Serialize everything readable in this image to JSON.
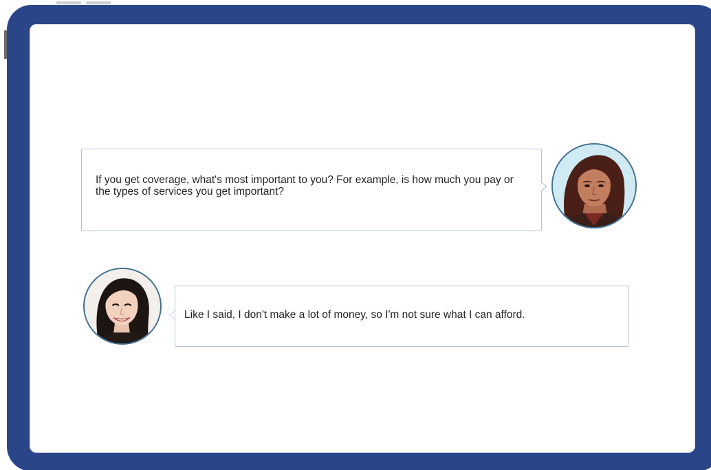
{
  "conversation": {
    "messages": [
      {
        "speaker": "agent",
        "avatar_icon": "woman-avatar-icon",
        "text": "If you get coverage, what's most important to you? For example, is how much you pay or the types of services you get important?"
      },
      {
        "speaker": "customer",
        "avatar_icon": "woman-avatar-icon",
        "text": "Like I said, I don't make a lot of money, so I'm not sure what I can afford."
      }
    ]
  },
  "colors": {
    "frame": "#2b4589",
    "bubble_border": "#b9c3d6",
    "avatar_border": "#3f6f91"
  }
}
